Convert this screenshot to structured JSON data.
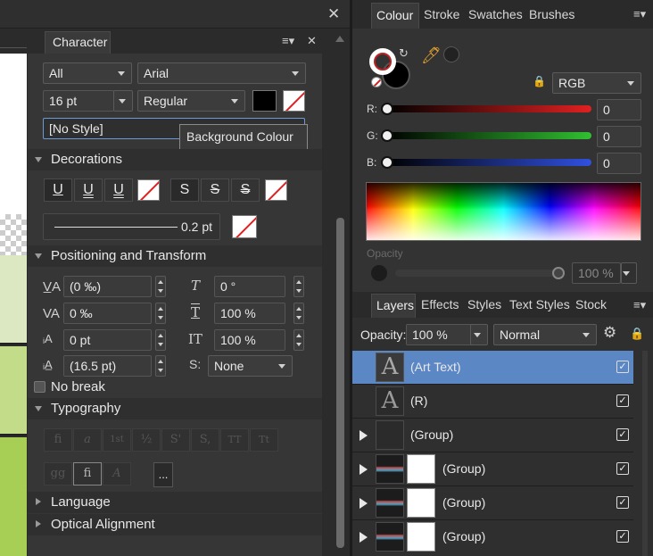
{
  "character": {
    "title": "Character",
    "font_collection": "All",
    "font_family": "Arial",
    "font_size": "16 pt",
    "font_style": "Regular",
    "style_field": "[No Style]",
    "tooltip": "Background Colour",
    "decorations": "Decorations",
    "underline_glyphs": [
      "U",
      "U",
      "U"
    ],
    "strike_glyphs": [
      "S",
      "S",
      "S"
    ],
    "line_weight": "0.2 pt",
    "positioning": "Positioning and Transform",
    "kerning": "(0 ‰)",
    "tracking": "0 ‰",
    "baseline": "0 pt",
    "leading": "(16.5 pt)",
    "shear": "0 °",
    "v_scale": "100 %",
    "h_scale": "100 %",
    "position": "None",
    "no_break": "No break",
    "typography": "Typography",
    "typo_row1": [
      "fi",
      "a",
      "1st",
      "½",
      "S'",
      "S,",
      "TT",
      "Tt"
    ],
    "typo_row2": [
      "gg",
      "fi",
      "A"
    ],
    "more": "...",
    "language": "Language",
    "optical": "Optical Alignment"
  },
  "colour_panel": {
    "tabs": [
      "Colour",
      "Stroke",
      "Swatches",
      "Brushes"
    ],
    "model": "RGB",
    "r_label": "R:",
    "g_label": "G:",
    "b_label": "B:",
    "r": "0",
    "g": "0",
    "b": "0",
    "opacity_label": "Opacity",
    "opacity": "100 %"
  },
  "layers_panel": {
    "tabs": [
      "Layers",
      "Effects",
      "Styles",
      "Text Styles",
      "Stock"
    ],
    "opacity_label": "Opacity:",
    "opacity": "100 %",
    "blend": "Normal",
    "layers": [
      {
        "name": "(Art Text)",
        "glyph": "A"
      },
      {
        "name": "(R)",
        "glyph": "A"
      },
      {
        "name": "(Group)"
      },
      {
        "name": "(Group)"
      },
      {
        "name": "(Group)"
      },
      {
        "name": "(Group)"
      }
    ]
  },
  "colors": {
    "accent": "#5a8fcf",
    "selected_layer": "#5b87c5"
  }
}
